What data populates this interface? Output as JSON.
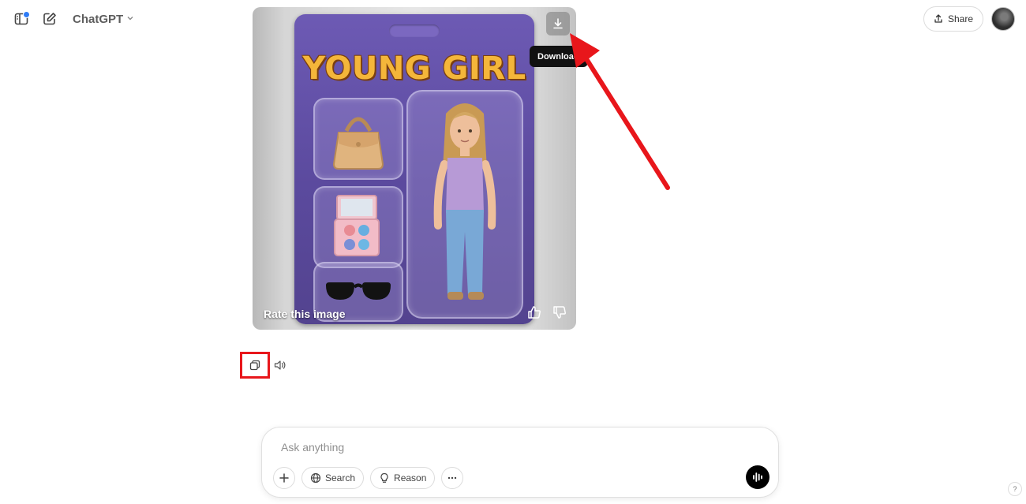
{
  "header": {
    "model_name": "ChatGPT",
    "share_label": "Share"
  },
  "image": {
    "package_title": "YOUNG GIRL",
    "rate_label": "Rate this image",
    "tooltip": "Download"
  },
  "composer": {
    "placeholder": "Ask anything",
    "search_label": "Search",
    "reason_label": "Reason"
  },
  "help_label": "?",
  "colors": {
    "accent_red": "#e8161b",
    "package_purple": "#5b4a9e",
    "title_gold": "#f4b63a"
  }
}
